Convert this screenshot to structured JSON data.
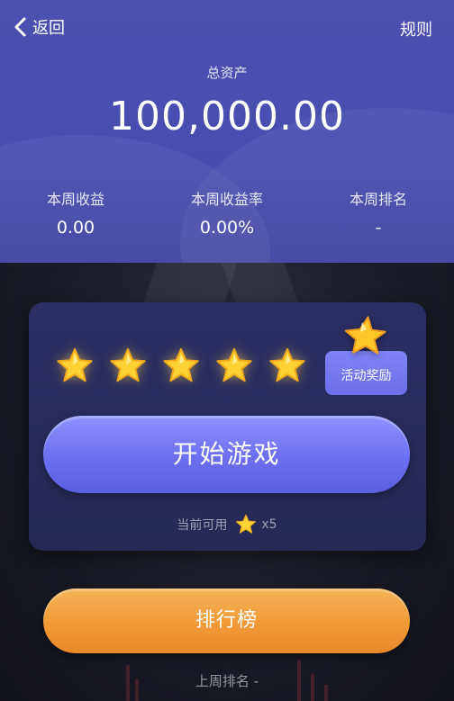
{
  "nav": {
    "back_label": "返回",
    "rules_label": "规则"
  },
  "assets": {
    "total_label": "总资产",
    "total_value": "100,000.00"
  },
  "stats": [
    {
      "label": "本周收益",
      "value": "0.00"
    },
    {
      "label": "本周收益率",
      "value": "0.00%"
    },
    {
      "label": "本周排名",
      "value": "-"
    }
  ],
  "game_card": {
    "stars_count": 5,
    "reward_label": "活动奖励",
    "start_label": "开始游戏",
    "available_label": "当前可用",
    "available_count": "x5"
  },
  "ranking": {
    "button_label": "排行榜",
    "last_week_text": "上周排名 -"
  },
  "colors": {
    "header_bg": "#4a4db0",
    "card_bg": "#2b2e63",
    "start_button": "#6a6ff0",
    "ranking_button": "#f09a36",
    "star": "#ffd233"
  }
}
